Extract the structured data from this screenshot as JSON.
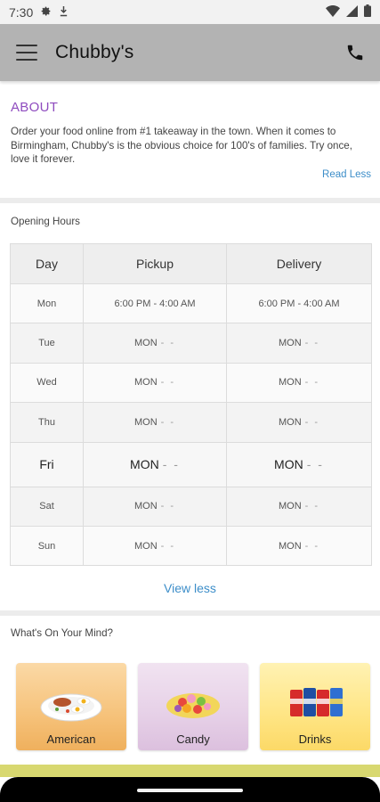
{
  "status_bar": {
    "time": "7:30",
    "icons": [
      "gear-icon",
      "download-icon",
      "wifi-icon",
      "signal-icon",
      "battery-icon"
    ]
  },
  "app_bar": {
    "title": "Chubby's",
    "menu_icon": "hamburger-menu-icon",
    "call_icon": "phone-icon"
  },
  "about": {
    "title": "ABOUT",
    "text": "Order your food online from #1 takeaway in the town. When it comes to Birmingham, Chubby's is the obvious choice for 100's of families. Try once, love it forever.",
    "toggle_label": "Read Less"
  },
  "opening_hours": {
    "title": "Opening Hours",
    "headers": {
      "day": "Day",
      "pickup": "Pickup",
      "delivery": "Delivery"
    },
    "rows": [
      {
        "day": "Mon",
        "pickup": "6:00 PM - 4:00 AM",
        "delivery": "6:00 PM - 4:00 AM"
      },
      {
        "day": "Tue",
        "pickup": "MON",
        "delivery": "MON"
      },
      {
        "day": "Wed",
        "pickup": "MON",
        "delivery": "MON"
      },
      {
        "day": "Thu",
        "pickup": "MON",
        "delivery": "MON"
      },
      {
        "day": "Fri",
        "pickup": "MON",
        "delivery": "MON"
      },
      {
        "day": "Sat",
        "pickup": "MON",
        "delivery": "MON"
      },
      {
        "day": "Sun",
        "pickup": "MON",
        "delivery": "MON"
      }
    ],
    "dash": "- -",
    "toggle_label": "View less"
  },
  "categories": {
    "title": "What's On Your Mind?",
    "items": [
      {
        "label": "American",
        "icon": "american-food-icon"
      },
      {
        "label": "Candy",
        "icon": "candy-icon"
      },
      {
        "label": "Drinks",
        "icon": "soda-cans-icon"
      }
    ]
  },
  "colors": {
    "accent": "#8f4cbf",
    "link": "#3d8ec9",
    "app_bar": "#b3b3b3"
  }
}
